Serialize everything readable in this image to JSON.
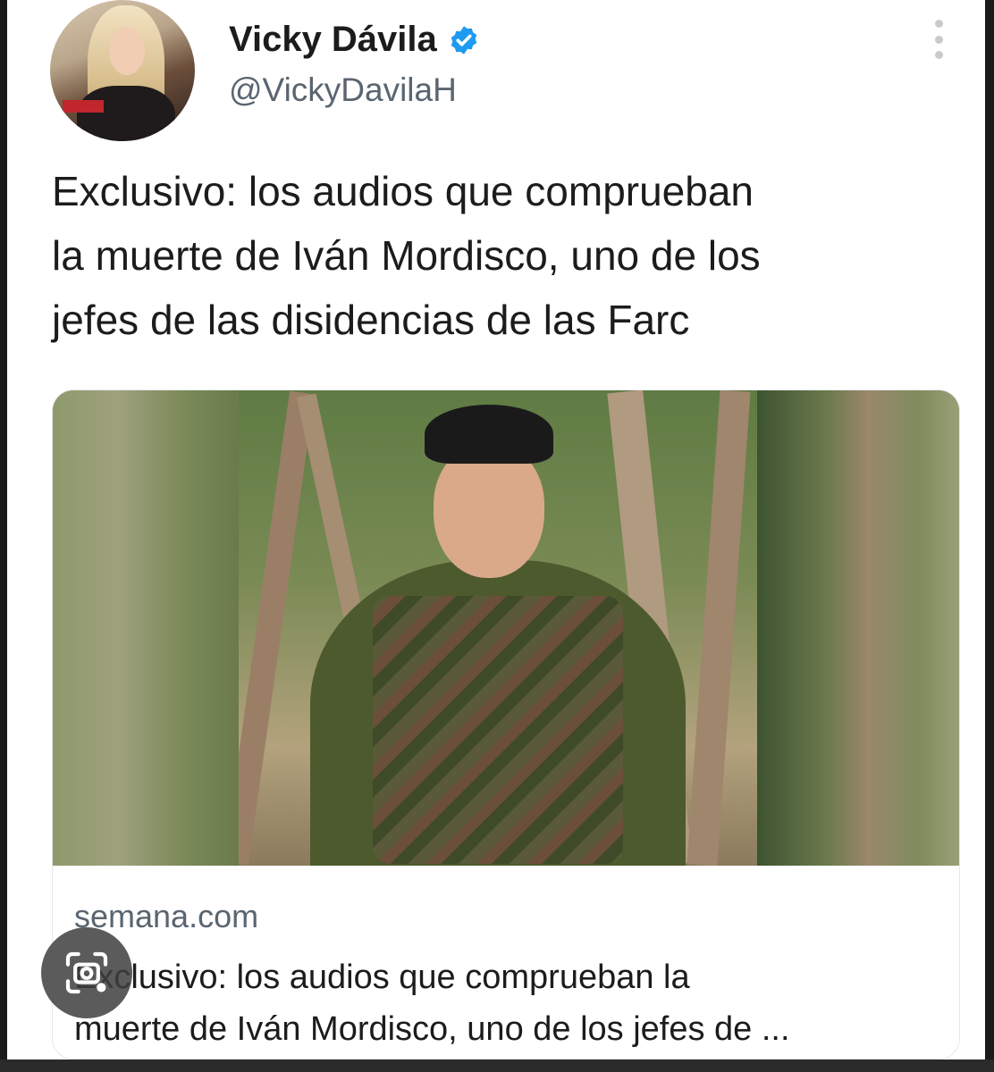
{
  "tweet": {
    "display_name": "Vicky Dávila",
    "handle": "@VickyDavilaH",
    "verified": true,
    "text_lines": [
      "Exclusivo: los audios que comprueban",
      "la muerte de Iván Mordisco, uno de los",
      "jefes de las disidencias de las Farc"
    ]
  },
  "link_card": {
    "domain": "semana.com",
    "title_lines": [
      "Exclusivo: los audios que comprueban la",
      "muerte de Iván Mordisco, uno de los jefes de ..."
    ]
  },
  "icons": {
    "verified": "verified-badge-icon",
    "more": "more-vertical-icon",
    "lens": "image-search-lens-icon"
  },
  "colors": {
    "verified_blue": "#1d9bf0",
    "text": "#1c1c1c",
    "muted": "#5a6570"
  }
}
